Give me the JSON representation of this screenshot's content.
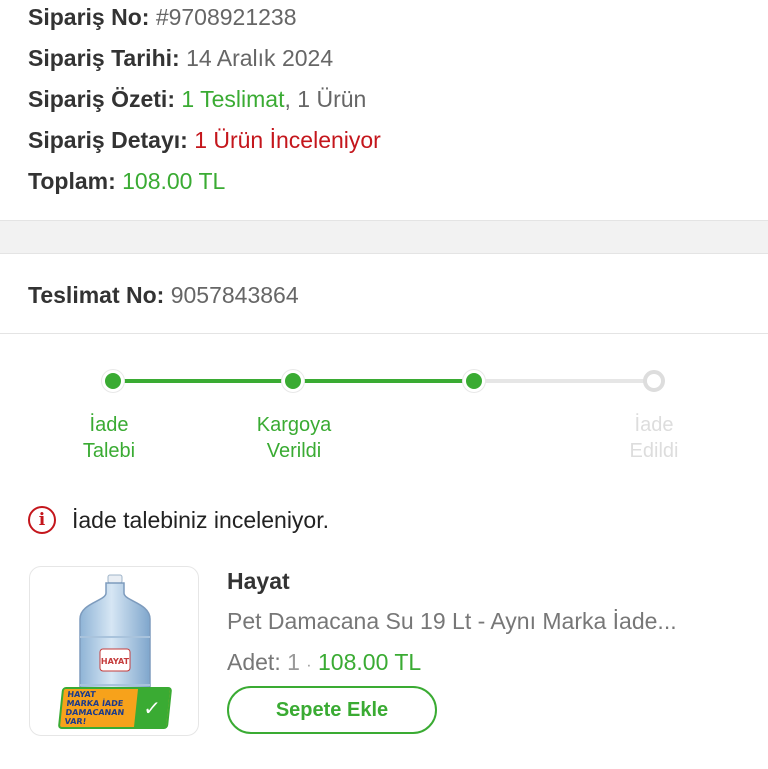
{
  "order": {
    "no_label": "Sipariş No:",
    "no_value": "#9708921238",
    "date_label": "Sipariş Tarihi:",
    "date_value": "14 Aralık 2024",
    "summary_label": "Sipariş Özeti:",
    "summary_deliveries": "1 Teslimat",
    "summary_sep": ",",
    "summary_items": "1 Ürün",
    "detail_label": "Sipariş Detayı:",
    "detail_value": "1 Ürün İnceleniyor",
    "total_label": "Toplam:",
    "total_value": "108.00 TL"
  },
  "delivery": {
    "no_label": "Teslimat No:",
    "no_value": "9057843864"
  },
  "tracker": {
    "steps": [
      {
        "label": "İade\nTalebi",
        "status": "done"
      },
      {
        "label": "Kargoya\nVerildi",
        "status": "done"
      },
      {
        "label": "",
        "status": "done"
      },
      {
        "label": "İade\nEdildi",
        "status": "pending"
      }
    ],
    "progress_fraction": 0.667
  },
  "notice": {
    "icon": "info-icon",
    "text": "İade talebiniz inceleniyor."
  },
  "product": {
    "brand": "Hayat",
    "name": "Pet Damacana Su 19 Lt - Aynı Marka İade...",
    "qty_label": "Adet:",
    "qty_value": "1",
    "qty_sep": "·",
    "price": "108.00 TL",
    "image_badge": {
      "line1": "HAYAT",
      "line2": "MARKA İADE",
      "line3": "DAMACANAN",
      "line4": "VAR!"
    },
    "bottle_logo": "HAYAT",
    "add_to_cart": "Sepete Ekle"
  },
  "colors": {
    "green": "#3aab33",
    "red": "#c4161c",
    "inactive": "#dddddd"
  }
}
